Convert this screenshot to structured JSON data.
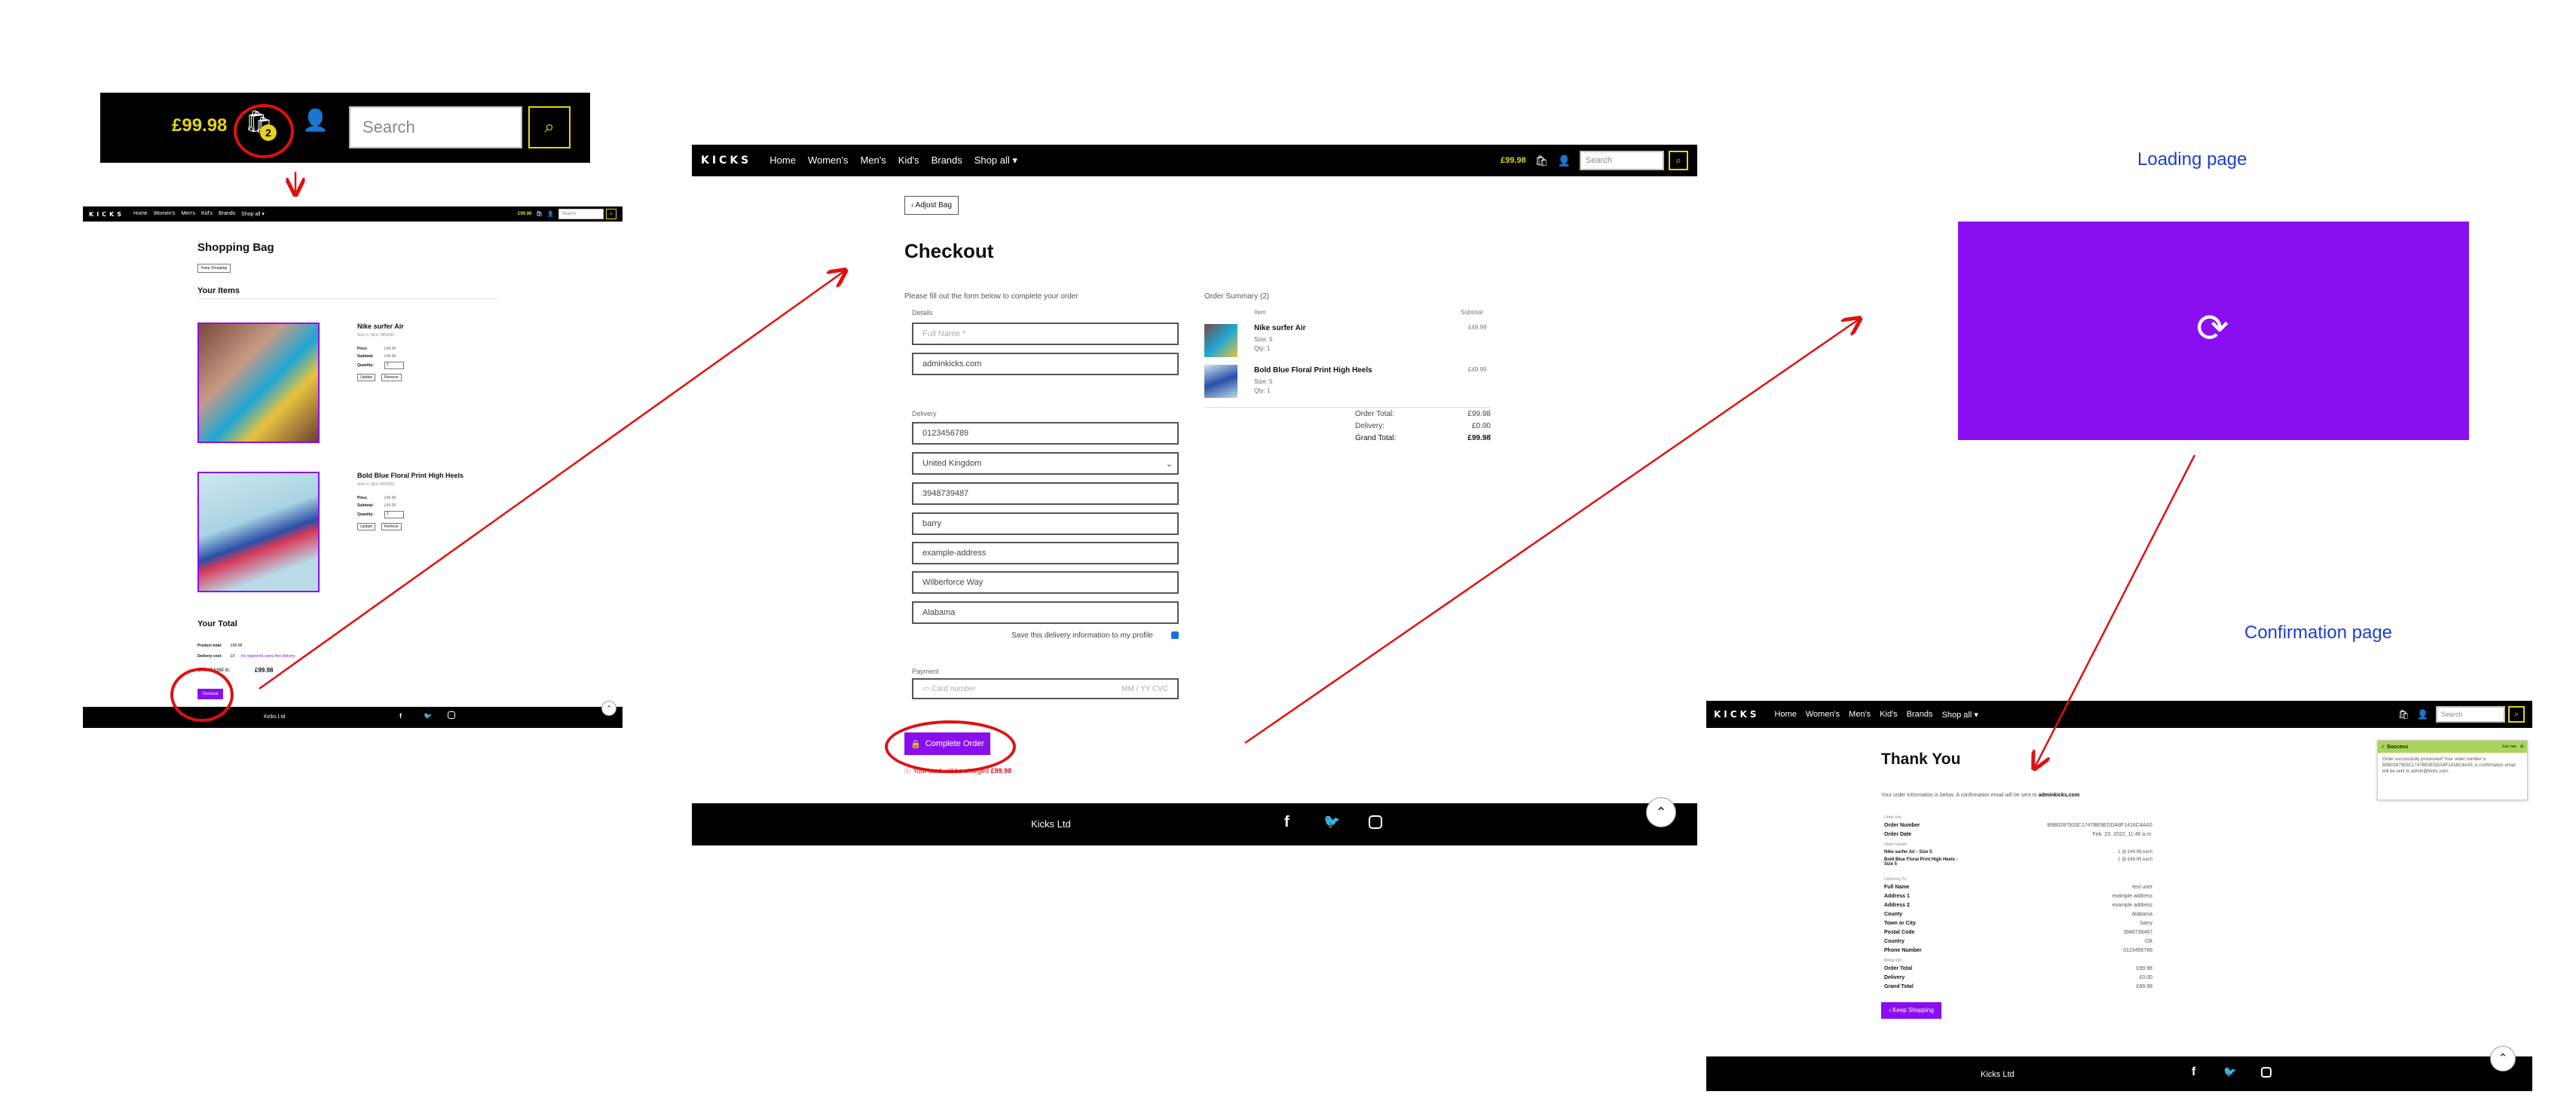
{
  "nav": {
    "logo": "KICKS",
    "links": [
      "Home",
      "Women's",
      "Men's",
      "Kid's",
      "Brands",
      "Shop all ▾"
    ],
    "bag_total": "£99.98",
    "bag_count": "2",
    "search_placeholder": "Search"
  },
  "zoom": {
    "bag_total": "£99.98",
    "bag_count": "2",
    "search_placeholder": "Search"
  },
  "bag": {
    "title": "Shopping Bag",
    "keep_shopping": "Keep Shopping",
    "your_items": "Your Items",
    "items": [
      {
        "name": "Nike surfer Air",
        "meta": "Size 5 | SKU 7859230",
        "price_label": "Price:",
        "price": "£49.99",
        "subtotal_label": "Subtotal:",
        "subtotal": "£49.99",
        "qty_label": "Quantity:",
        "qty": "1",
        "update": "Update",
        "remove": "Remove"
      },
      {
        "name": "Bold Blue Floral Print High Heels",
        "meta": "Size 5 | SKU 4459236",
        "price_label": "Price:",
        "price": "£49.99",
        "subtotal_label": "Subtotal:",
        "subtotal": "£49.99",
        "qty_label": "Quantity:",
        "qty": "1",
        "update": "Update",
        "remove": "Remove"
      }
    ],
    "your_total": "Your Total",
    "product_total_label": "Product total:",
    "product_total": "£99.98",
    "delivery_label": "Delivery cost:",
    "delivery": "£0",
    "delivery_note": "for registered users free delivery",
    "grand_label": "Grand total is:",
    "grand": "£99.98",
    "checkout": "Checkout",
    "footer": "Kicks Ltd"
  },
  "checkout": {
    "adjust_bag": "‹ Adjust Bag",
    "title": "Checkout",
    "intro": "Please fill out the form below to complete your order",
    "details_label": "Details",
    "full_name_placeholder": "Full Name *",
    "email": "adminkicks.com",
    "delivery_label": "Delivery",
    "phone": "0123456789",
    "country": "United Kingdom",
    "postcode": "3948739487",
    "town": "barry",
    "address1": "example-address",
    "address2": "Wilberforce Way",
    "county": "Alabama",
    "save_info": "Save this delivery information to my profile",
    "payment_label": "Payment",
    "card_placeholder": "Card number",
    "card_date": "MM / YY  CVC",
    "complete_btn": "Complete Order",
    "charge_note": "Your card will be charged",
    "charge_amount": "£99.98",
    "summary_title": "Order Summary (2)",
    "item_col": "Item",
    "subtotal_col": "Subtotal",
    "items": [
      {
        "name": "Nike surfer Air",
        "size": "Size: 5",
        "qty": "Qty: 1",
        "price": "£49.99"
      },
      {
        "name": "Bold Blue Floral Print High Heels",
        "size": "Size: 5",
        "qty": "Qty: 1",
        "price": "£49.99"
      }
    ],
    "order_total_label": "Order Total:",
    "order_total": "£99.98",
    "delivery_total_label": "Delivery:",
    "delivery_total": "£0.00",
    "grand_total_label": "Grand Total:",
    "grand_total": "£99.98",
    "footer": "Kicks Ltd",
    "nav_total": "£99.98"
  },
  "loading": {
    "caption": "Loading page"
  },
  "confirmation": {
    "caption": "Confirmation page",
    "title": "Thank You",
    "intro": "Your order information is below. A confirmation email will be sent to",
    "email": "adminkicks.com",
    "toast_title": "Success",
    "toast_sub": "Just now",
    "toast_body": "Order successfully processed! Your order number is B9B0287933C1747BE9EDDA8F1416C4AA5. A confirmation email will be sent to admin@kicks.com.",
    "order_info": "Order Info:",
    "order_number_label": "Order Number",
    "order_number": "B9B0287933C1747BE9EDDA8F1416C4AA5",
    "order_date_label": "Order Date",
    "order_date": "Feb. 23, 2022, 11:46 a.m.",
    "order_details": "Order Details:",
    "line1": "Nike surfer Air - Size 5",
    "line1_val": "1 @ £49.99 each",
    "line2": "Bold Blue Floral Print High Heels - Size 5",
    "line2_val": "1 @ £49.99 each",
    "delivering_to": "Delivering To:",
    "fields": [
      {
        "label": "Full Name",
        "value": "test user"
      },
      {
        "label": "Address 1",
        "value": "example address"
      },
      {
        "label": "Address 2",
        "value": "example address"
      },
      {
        "label": "County",
        "value": "Alabama"
      },
      {
        "label": "Town or City",
        "value": "barry"
      },
      {
        "label": "Postal Code",
        "value": "3948739487"
      },
      {
        "label": "Country",
        "value": "GB"
      },
      {
        "label": "Phone Number",
        "value": "0123456789"
      }
    ],
    "billing_info": "Billing Info:",
    "order_total_label": "Order Total",
    "order_total": "£99.98",
    "delivery_label": "Delivery",
    "delivery": "£0.00",
    "grand_total_label": "Grand Total",
    "grand_total": "£99.98",
    "keep_shopping": "‹ Keep Shopping",
    "footer": "Kicks Ltd"
  },
  "colors": {
    "accent": "#8a0ff0",
    "nav": "#000000",
    "highlight": "#e5d31c",
    "annotation": "#e01010",
    "caption": "#1a3fcf"
  }
}
